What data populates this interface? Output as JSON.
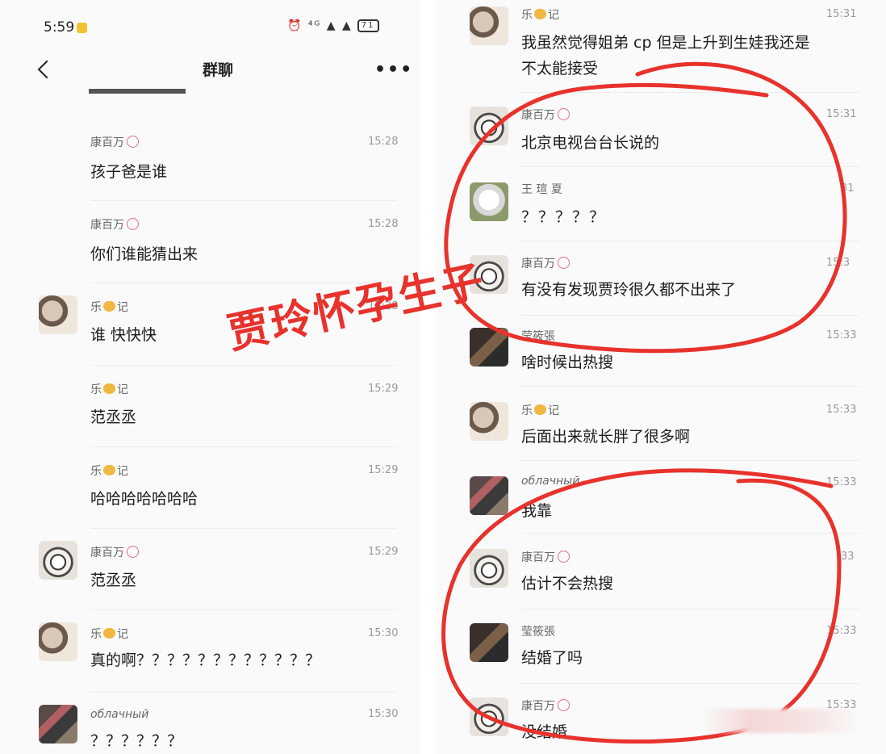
{
  "status_bar": {
    "time": "5:59",
    "icons": "⏰ ⁴ᴳ ▲ ▲",
    "battery": "71"
  },
  "header": {
    "title": "群聊",
    "more": "•••"
  },
  "left_messages": [
    {
      "sender": "康百万",
      "time": "15:28",
      "text": "孩子爸是谁"
    },
    {
      "sender": "康百万",
      "time": "15:28",
      "text": "你们谁能猜出来"
    },
    {
      "sender": "乐",
      "sender_suffix": "记",
      "time": "15:28",
      "text": "谁 快快快"
    },
    {
      "sender": "乐",
      "sender_suffix": "记",
      "time": "15:29",
      "text": "范丞丞"
    },
    {
      "sender": "乐",
      "sender_suffix": "记",
      "time": "15:29",
      "text": "哈哈哈哈哈哈哈"
    },
    {
      "sender": "康百万",
      "time": "15:29",
      "text": "范丞丞"
    },
    {
      "sender": "乐",
      "sender_suffix": "记",
      "time": "15:30",
      "text": "真的啊？？？？？？？？？？？？"
    },
    {
      "sender": "облачный",
      "time": "15:30",
      "text": "？？？？？？"
    }
  ],
  "right_messages": [
    {
      "sender": "乐",
      "sender_suffix": "记",
      "time": "15:31",
      "text": "我虽然觉得姐弟 cp 但是上升到生娃我还是",
      "text2": "不太能接受"
    },
    {
      "sender": "康百万",
      "time": "15:31",
      "text": "北京电视台台长说的"
    },
    {
      "sender": "王 瑄 夏",
      "time": "31",
      "text": "？？？？？"
    },
    {
      "sender": "康百万",
      "time": "15:3",
      "text": "有没有发现贾玲很久都不出来了"
    },
    {
      "sender": "莹筱張",
      "time": "15:33",
      "text": "啥时候出热搜"
    },
    {
      "sender": "乐",
      "sender_suffix": "记",
      "time": "15:33",
      "text": "后面出来就长胖了很多啊"
    },
    {
      "sender": "облачный",
      "time": "15:33",
      "text": "我靠"
    },
    {
      "sender": "康百万",
      "time": "33",
      "text": "估计不会热搜"
    },
    {
      "sender": "莹筱張",
      "time": "15:33",
      "text": "结婚了吗"
    },
    {
      "sender": "康百万",
      "time": "15:33",
      "text": "没结婚"
    }
  ],
  "annotation": {
    "text": "贾玲怀孕生子",
    "color": "#e8322c"
  }
}
